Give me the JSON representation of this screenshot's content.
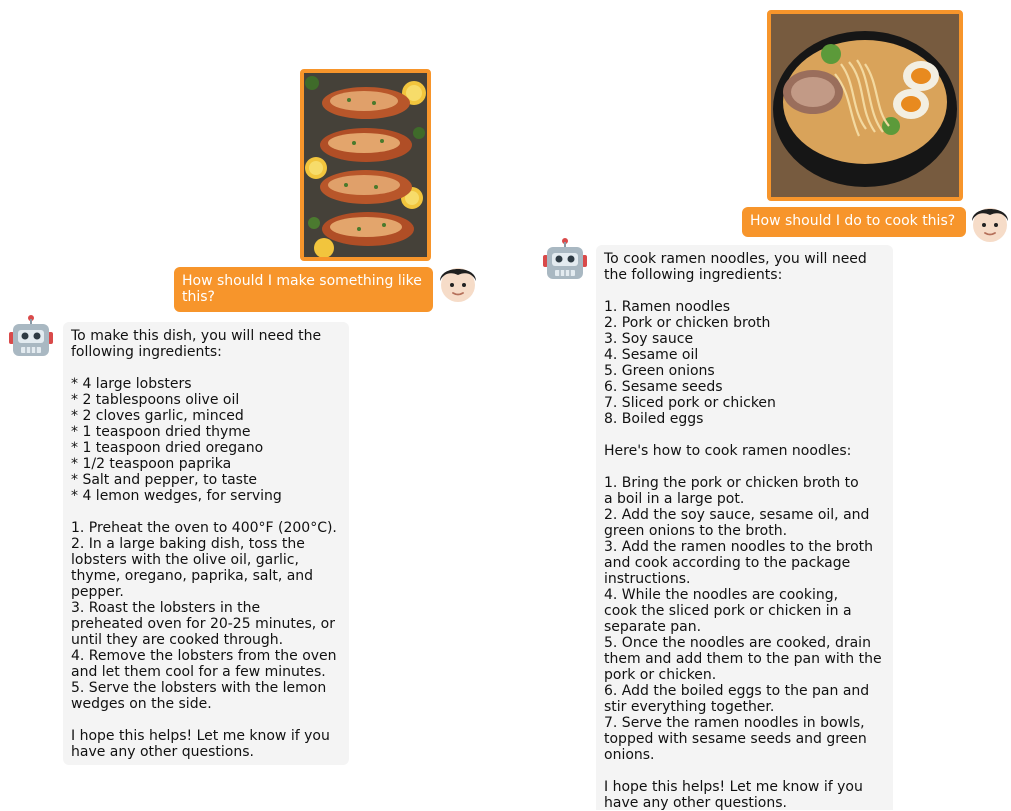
{
  "conversation_left": {
    "user_message": "How should I make something like this?",
    "image_subject": "roasted lobster tails with lemon slices",
    "bot_message": "To make this dish, you will need the\nfollowing ingredients:\n\n* 4 large lobsters\n* 2 tablespoons olive oil\n* 2 cloves garlic, minced\n* 1 teaspoon dried thyme\n* 1 teaspoon dried oregano\n* 1/2 teaspoon paprika\n* Salt and pepper, to taste\n* 4 lemon wedges, for serving\n\n1. Preheat the oven to 400°F (200°C).\n2. In a large baking dish, toss the\nlobsters with the olive oil, garlic,\nthyme, oregano, paprika, salt, and\npepper.\n3. Roast the lobsters in the\npreheated oven for 20-25 minutes, or\nuntil they are cooked through.\n4. Remove the lobsters from the oven\nand let them cool for a few minutes.\n5. Serve the lobsters with the lemon\nwedges on the side.\n\nI hope this helps! Let me know if you\nhave any other questions."
  },
  "conversation_right": {
    "user_message": "How should I do to cook this?",
    "image_subject": "bowl of ramen with pork, soft-boiled eggs and greens",
    "bot_message": "To cook ramen noodles, you will need\nthe following ingredients:\n\n1. Ramen noodles\n2. Pork or chicken broth\n3. Soy sauce\n4. Sesame oil\n5. Green onions\n6. Sesame seeds\n7. Sliced pork or chicken\n8. Boiled eggs\n\nHere's how to cook ramen noodles:\n\n1. Bring the pork or chicken broth to\na boil in a large pot.\n2. Add the soy sauce, sesame oil, and\ngreen onions to the broth.\n3. Add the ramen noodles to the broth\nand cook according to the package\ninstructions.\n4. While the noodles are cooking,\ncook the sliced pork or chicken in a\nseparate pan.\n5. Once the noodles are cooked, drain\nthem and add them to the pan with the\npork or chicken.\n6. Add the boiled eggs to the pan and\nstir everything together.\n7. Serve the ramen noodles in bowls,\ntopped with sesame seeds and green\nonions.\n\nI hope this helps! Let me know if you\nhave any other questions."
  },
  "icons": {
    "user": "boy-face-icon",
    "bot": "robot-face-icon"
  },
  "colors": {
    "accent": "#f7952b",
    "bot_bubble": "#f4f4f4",
    "user_text": "#ffffff"
  }
}
